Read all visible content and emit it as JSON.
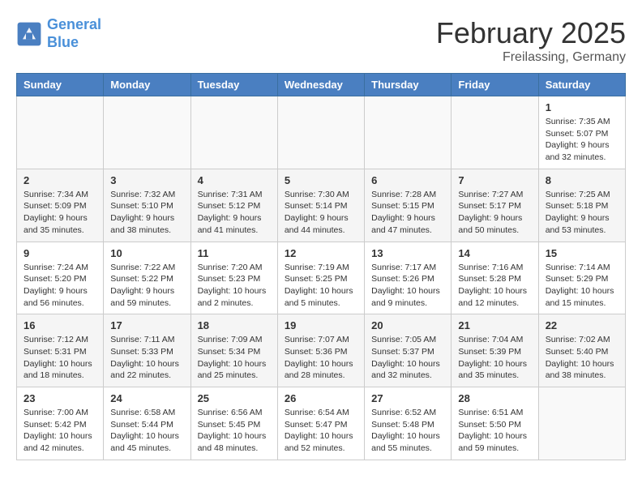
{
  "header": {
    "logo_line1": "General",
    "logo_line2": "Blue",
    "month_title": "February 2025",
    "location": "Freilassing, Germany"
  },
  "weekdays": [
    "Sunday",
    "Monday",
    "Tuesday",
    "Wednesday",
    "Thursday",
    "Friday",
    "Saturday"
  ],
  "weeks": [
    [
      {
        "day": "",
        "info": ""
      },
      {
        "day": "",
        "info": ""
      },
      {
        "day": "",
        "info": ""
      },
      {
        "day": "",
        "info": ""
      },
      {
        "day": "",
        "info": ""
      },
      {
        "day": "",
        "info": ""
      },
      {
        "day": "1",
        "info": "Sunrise: 7:35 AM\nSunset: 5:07 PM\nDaylight: 9 hours and 32 minutes."
      }
    ],
    [
      {
        "day": "2",
        "info": "Sunrise: 7:34 AM\nSunset: 5:09 PM\nDaylight: 9 hours and 35 minutes."
      },
      {
        "day": "3",
        "info": "Sunrise: 7:32 AM\nSunset: 5:10 PM\nDaylight: 9 hours and 38 minutes."
      },
      {
        "day": "4",
        "info": "Sunrise: 7:31 AM\nSunset: 5:12 PM\nDaylight: 9 hours and 41 minutes."
      },
      {
        "day": "5",
        "info": "Sunrise: 7:30 AM\nSunset: 5:14 PM\nDaylight: 9 hours and 44 minutes."
      },
      {
        "day": "6",
        "info": "Sunrise: 7:28 AM\nSunset: 5:15 PM\nDaylight: 9 hours and 47 minutes."
      },
      {
        "day": "7",
        "info": "Sunrise: 7:27 AM\nSunset: 5:17 PM\nDaylight: 9 hours and 50 minutes."
      },
      {
        "day": "8",
        "info": "Sunrise: 7:25 AM\nSunset: 5:18 PM\nDaylight: 9 hours and 53 minutes."
      }
    ],
    [
      {
        "day": "9",
        "info": "Sunrise: 7:24 AM\nSunset: 5:20 PM\nDaylight: 9 hours and 56 minutes."
      },
      {
        "day": "10",
        "info": "Sunrise: 7:22 AM\nSunset: 5:22 PM\nDaylight: 9 hours and 59 minutes."
      },
      {
        "day": "11",
        "info": "Sunrise: 7:20 AM\nSunset: 5:23 PM\nDaylight: 10 hours and 2 minutes."
      },
      {
        "day": "12",
        "info": "Sunrise: 7:19 AM\nSunset: 5:25 PM\nDaylight: 10 hours and 5 minutes."
      },
      {
        "day": "13",
        "info": "Sunrise: 7:17 AM\nSunset: 5:26 PM\nDaylight: 10 hours and 9 minutes."
      },
      {
        "day": "14",
        "info": "Sunrise: 7:16 AM\nSunset: 5:28 PM\nDaylight: 10 hours and 12 minutes."
      },
      {
        "day": "15",
        "info": "Sunrise: 7:14 AM\nSunset: 5:29 PM\nDaylight: 10 hours and 15 minutes."
      }
    ],
    [
      {
        "day": "16",
        "info": "Sunrise: 7:12 AM\nSunset: 5:31 PM\nDaylight: 10 hours and 18 minutes."
      },
      {
        "day": "17",
        "info": "Sunrise: 7:11 AM\nSunset: 5:33 PM\nDaylight: 10 hours and 22 minutes."
      },
      {
        "day": "18",
        "info": "Sunrise: 7:09 AM\nSunset: 5:34 PM\nDaylight: 10 hours and 25 minutes."
      },
      {
        "day": "19",
        "info": "Sunrise: 7:07 AM\nSunset: 5:36 PM\nDaylight: 10 hours and 28 minutes."
      },
      {
        "day": "20",
        "info": "Sunrise: 7:05 AM\nSunset: 5:37 PM\nDaylight: 10 hours and 32 minutes."
      },
      {
        "day": "21",
        "info": "Sunrise: 7:04 AM\nSunset: 5:39 PM\nDaylight: 10 hours and 35 minutes."
      },
      {
        "day": "22",
        "info": "Sunrise: 7:02 AM\nSunset: 5:40 PM\nDaylight: 10 hours and 38 minutes."
      }
    ],
    [
      {
        "day": "23",
        "info": "Sunrise: 7:00 AM\nSunset: 5:42 PM\nDaylight: 10 hours and 42 minutes."
      },
      {
        "day": "24",
        "info": "Sunrise: 6:58 AM\nSunset: 5:44 PM\nDaylight: 10 hours and 45 minutes."
      },
      {
        "day": "25",
        "info": "Sunrise: 6:56 AM\nSunset: 5:45 PM\nDaylight: 10 hours and 48 minutes."
      },
      {
        "day": "26",
        "info": "Sunrise: 6:54 AM\nSunset: 5:47 PM\nDaylight: 10 hours and 52 minutes."
      },
      {
        "day": "27",
        "info": "Sunrise: 6:52 AM\nSunset: 5:48 PM\nDaylight: 10 hours and 55 minutes."
      },
      {
        "day": "28",
        "info": "Sunrise: 6:51 AM\nSunset: 5:50 PM\nDaylight: 10 hours and 59 minutes."
      },
      {
        "day": "",
        "info": ""
      }
    ]
  ]
}
